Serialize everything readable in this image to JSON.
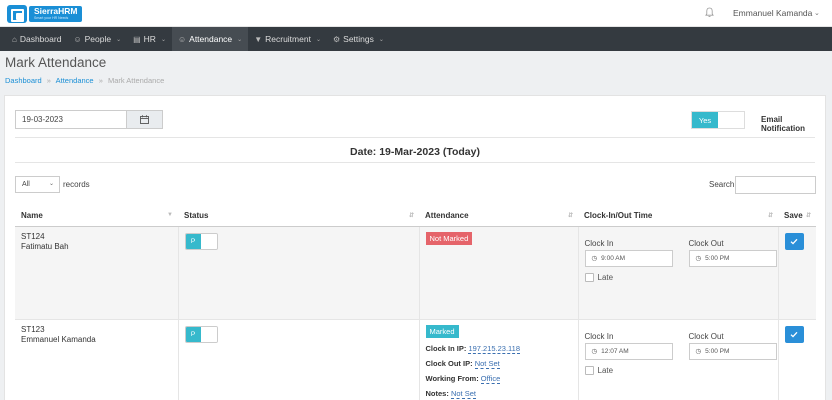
{
  "header": {
    "logo_text": "SierraHRM",
    "logo_tagline": "Smart your HR Needs",
    "user_name": "Emmanuel Kamanda"
  },
  "nav": {
    "dashboard": "Dashboard",
    "people": "People",
    "hr": "HR",
    "attendance": "Attendance",
    "recruitment": "Recruitment",
    "settings": "Settings"
  },
  "page": {
    "title": "Mark Attendance",
    "breadcrumb": [
      "Dashboard",
      "Attendance",
      "Mark Attendance"
    ]
  },
  "controls": {
    "date_value": "19-03-2023",
    "email_toggle": "Yes",
    "email_label": "Email Notification",
    "date_heading": "Date: 19-Mar-2023 (Today)",
    "length_value": "All",
    "records_label": "records",
    "search_label": "Search:"
  },
  "table": {
    "headers": {
      "name": "Name",
      "status": "Status",
      "attendance": "Attendance",
      "clock": "Clock-In/Out Time",
      "save": "Save"
    },
    "rows": [
      {
        "id": "ST124",
        "name": "Fatimatu Bah",
        "status": "P",
        "attendance_badge": "Not Marked",
        "clock_in_label": "Clock In",
        "clock_out_label": "Clock Out",
        "clock_in": "9:00 AM",
        "clock_out": "5:00 PM",
        "late_label": "Late"
      },
      {
        "id": "ST123",
        "name": "Emmanuel Kamanda",
        "status": "P",
        "attendance_badge": "Marked",
        "clock_in_ip_label": "Clock In IP:",
        "clock_in_ip": "197.215.23.118",
        "clock_out_ip_label": "Clock Out IP:",
        "clock_out_ip": "Not Set",
        "working_from_label": "Working From:",
        "working_from": "Office",
        "notes_label": "Notes:",
        "notes": "Not Set",
        "clock_in_label": "Clock In",
        "clock_out_label": "Clock Out",
        "clock_in": "12:07 AM",
        "clock_out": "5:00 PM",
        "late_label": "Late"
      }
    ]
  },
  "colors": {
    "nav_bg": "#343a40",
    "brand": "#1a8fd6",
    "accent_cyan": "#36b9cc",
    "danger": "#e5646a",
    "save_btn": "#2a8fd8"
  }
}
